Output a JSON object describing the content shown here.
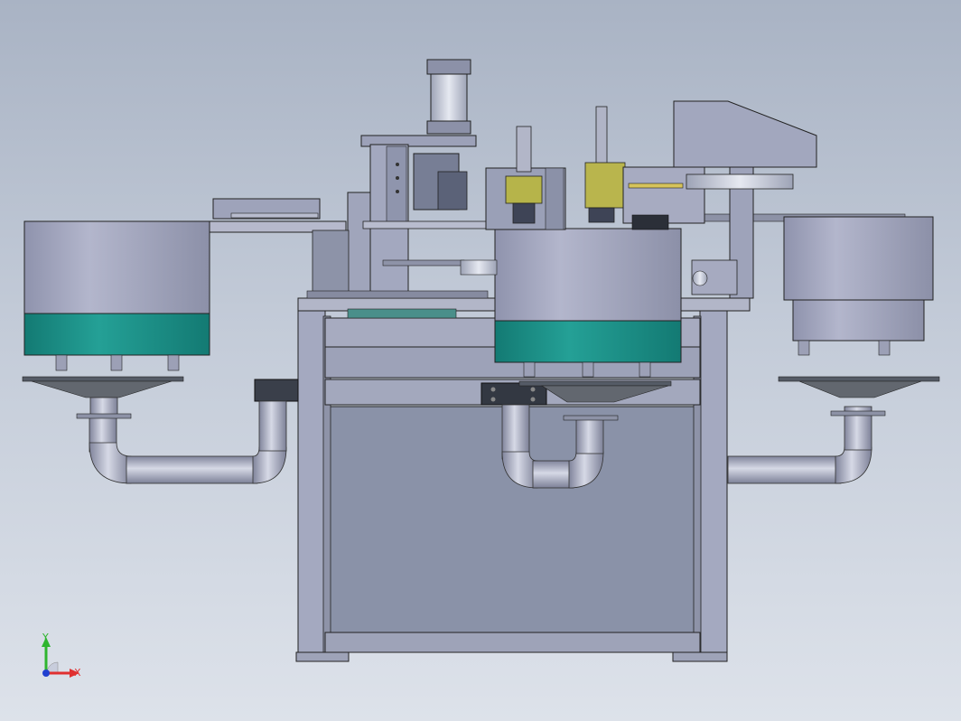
{
  "viewport": {
    "background_top": "#a9b3c4",
    "background_bottom": "#dde2ea"
  },
  "model": {
    "frame_color": "#8a93a8",
    "housing_color": "#9ea3bc",
    "accent_color": "#1a8f86",
    "tube_color": "#b4b8c9"
  },
  "axis_triad": {
    "y_label": "Y",
    "x_label": "X",
    "y_color": "#2fb52f",
    "x_color": "#e03030",
    "z_color": "#2040d0"
  }
}
